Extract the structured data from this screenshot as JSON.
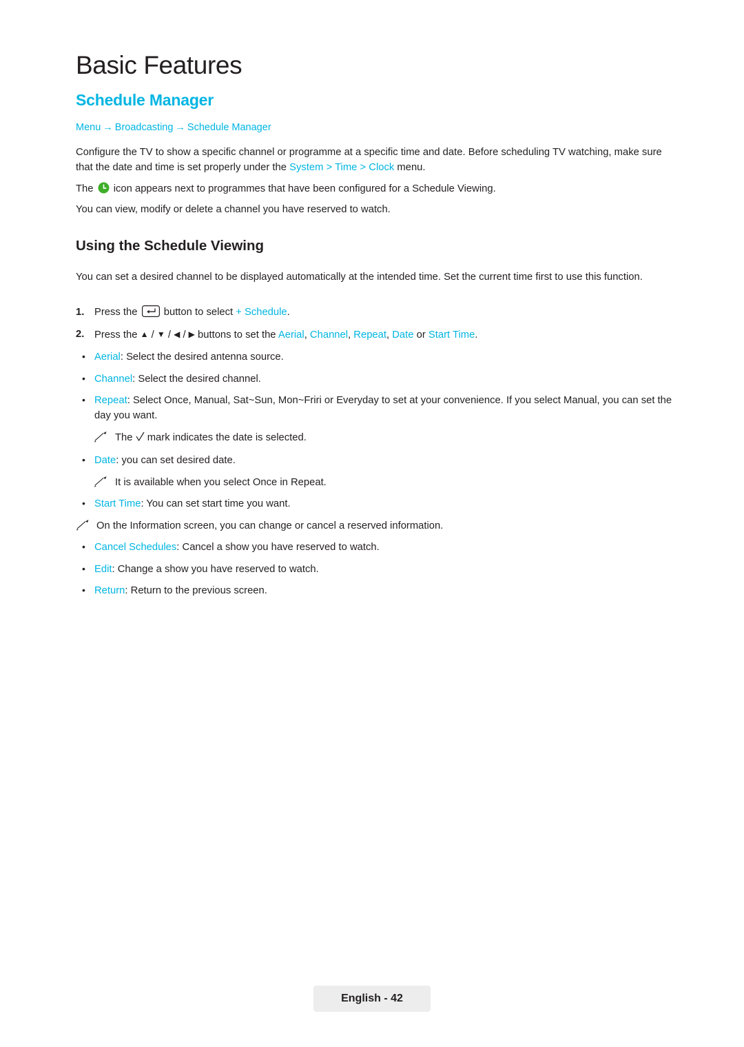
{
  "chapter": "Basic Features",
  "section": "Schedule Manager",
  "breadcrumb": {
    "items": [
      "Menu",
      "Broadcasting",
      "Schedule Manager"
    ],
    "separator": "→"
  },
  "intro": {
    "para1_a": "Configure the TV to show a specific channel or programme at a specific time and date. Before scheduling TV watching, make sure that the date and time is set properly under the ",
    "para1_sys": "System",
    "para1_gt1": " > ",
    "para1_time": "Time",
    "para1_gt2": " > ",
    "para1_clock": "Clock",
    "para1_b": " menu.",
    "para2_a": "The ",
    "para2_b": " icon appears next to programmes that have been configured for a Schedule Viewing.",
    "para3": "You can view, modify or delete a channel you have reserved to watch."
  },
  "subhead": "Using the Schedule Viewing",
  "subintro": "You can set a desired channel to be displayed automatically at the intended time. Set the current time first to use this function.",
  "steps": [
    {
      "num": "1.",
      "pre": "Press the ",
      "mid": " button to select ",
      "link": "+ Schedule",
      "post": "."
    },
    {
      "num": "2.",
      "pre": "Press the ",
      "keys_sep": " / ",
      "mid": " buttons to set the ",
      "link1": "Aerial",
      "sep1": ", ",
      "link2": "Channel",
      "sep2": ", ",
      "link3": "Repeat",
      "sep3": ", ",
      "link4": "Date",
      "sep4": " or ",
      "link5": "Start Time",
      "post": "."
    }
  ],
  "bullets": [
    {
      "term": "Aerial",
      "text": ": Select the desired antenna source."
    },
    {
      "term": "Channel",
      "text": ": Select the desired channel."
    },
    {
      "term": "Repeat",
      "text": ": Select Once, Manual, Sat~Sun, Mon~Friri or Everyday to set at your convenience. If you select Manual, you can set the day you want."
    }
  ],
  "note_repeat": {
    "pre": "The ",
    "post": " mark indicates the date is selected."
  },
  "bullet_date": {
    "term": "Date",
    "text": ": you can set desired date."
  },
  "note_date": "It is available when you select Once in Repeat.",
  "bullet_starttime": {
    "term": "Start Time",
    "text": ": You can set start time you want."
  },
  "note_info": "On the Information screen, you can change or cancel a reserved information.",
  "bullets2": [
    {
      "term": "Cancel Schedules",
      "text": ": Cancel a show you have reserved to watch."
    },
    {
      "term": "Edit",
      "text": ": Change a show you have reserved to watch."
    },
    {
      "term": "Return",
      "text": ": Return to the previous screen."
    }
  ],
  "bullet_marker": "•",
  "footer": "English - 42",
  "colors": {
    "accent": "#00b5e2",
    "text": "#231f20",
    "footer_bg": "#ededed",
    "icon_green": "#3fae29"
  }
}
